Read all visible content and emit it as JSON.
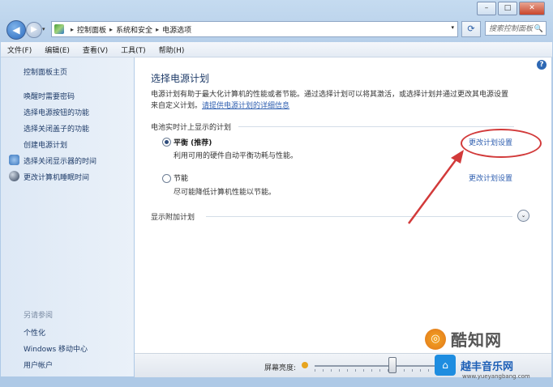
{
  "window": {
    "caption": {
      "minimize": "–",
      "maximize": "□",
      "close": "✕"
    }
  },
  "nav": {
    "back": "◀",
    "forward": "▶",
    "recent": "▾",
    "breadcrumbs": [
      "控制面板",
      "系统和安全",
      "电源选项"
    ],
    "separator": "▸",
    "refresh": "⟳",
    "search_placeholder": "搜索控制面板",
    "search_icon": "🔍"
  },
  "menubar": [
    "文件(F)",
    "编辑(E)",
    "查看(V)",
    "工具(T)",
    "帮助(H)"
  ],
  "sidebar": {
    "home": "控制面板主页",
    "links": [
      "唤醒时需要密码",
      "选择电源按钮的功能",
      "选择关闭盖子的功能",
      "创建电源计划",
      "选择关闭显示器的时间",
      "更改计算机睡眠时间"
    ],
    "see_also": "另请参阅",
    "related": [
      "个性化",
      "Windows 移动中心",
      "用户帐户"
    ]
  },
  "main": {
    "help": "?",
    "title": "选择电源计划",
    "desc_line1": "电源计划有助于最大化计算机的性能或者节能。通过选择计划可以将其激活，或选择计划并通过更改其电源设置",
    "desc_line2_prefix": "来自定义计划。",
    "desc_link": "请提供电源计划的详细信息",
    "group_head": "电池实时计上显示的计划",
    "plans": [
      {
        "name": "平衡 (推荐)",
        "desc": "利用可用的硬件自动平衡功耗与性能。",
        "link": "更改计划设置",
        "selected": true
      },
      {
        "name": "节能",
        "desc": "尽可能降低计算机性能以节能。",
        "link": "更改计划设置",
        "selected": false
      }
    ],
    "extra_plans": "显示附加计划",
    "expand_icon": "⌄"
  },
  "bottom": {
    "brightness_label": "屏幕亮度:",
    "brightness_level": 0.64
  },
  "watermark": {
    "logo_char": "◎",
    "brand1": "酷知网",
    "brand2": "越丰音乐网",
    "url": "www.yueyangbang.com",
    "house": "⌂"
  },
  "colors": {
    "annotation": "#d23a3a",
    "link": "#2f5fb0"
  }
}
